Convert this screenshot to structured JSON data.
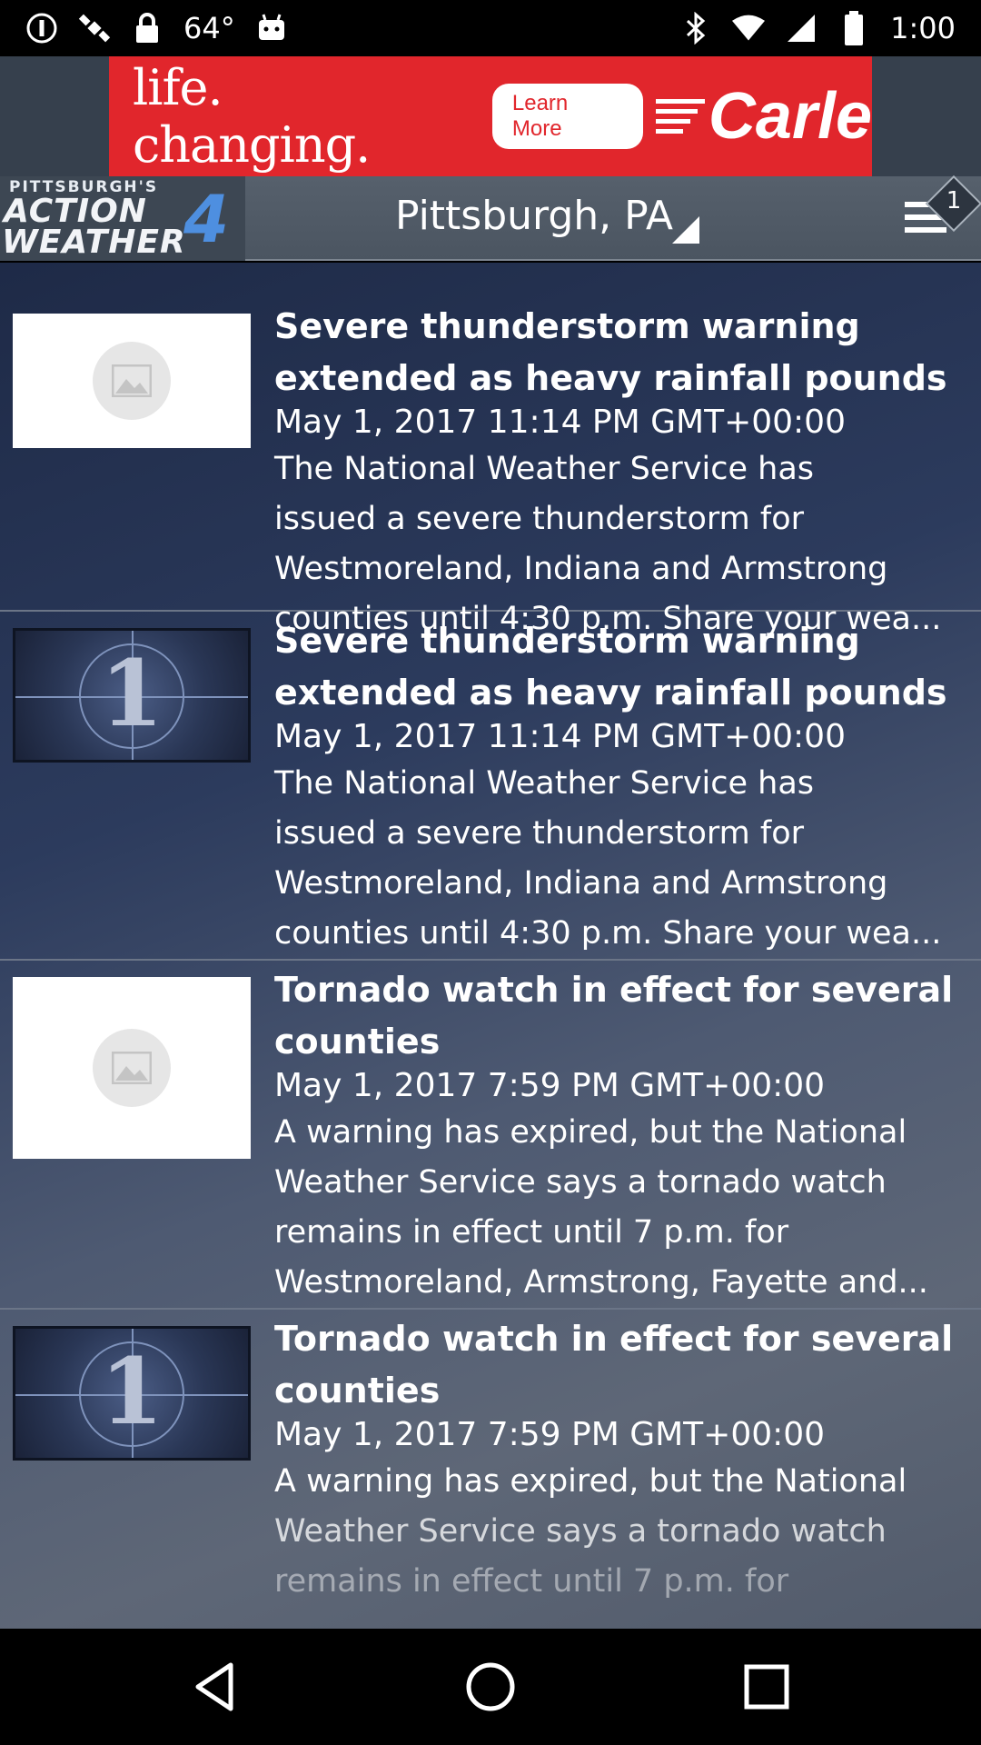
{
  "status_bar": {
    "temperature": "64°",
    "time": "1:00",
    "icons": [
      "info-icon",
      "satellite-icon",
      "lock-icon",
      "android-icon",
      "bluetooth-icon",
      "wifi-icon",
      "signal-icon",
      "battery-icon"
    ]
  },
  "ad": {
    "tagline": "life. changing.",
    "cta": "Learn More",
    "brand": "Carle",
    "color": "#e1262c"
  },
  "header": {
    "logo_top": "PITTSBURGH'S",
    "logo_line1": "ACTION",
    "logo_line2": "WEATHER",
    "logo_number": "4",
    "location": "Pittsburgh, PA",
    "badge_count": "1"
  },
  "articles": [
    {
      "thumbnail": "placeholder-image-icon",
      "title": "Severe thunderstorm warning extended as heavy rainfall pounds",
      "date": "May 1, 2017 11:14 PM GMT+00:00",
      "desc_lines": [
        "The National Weather Service has",
        "issued a severe thunderstorm for",
        "Westmoreland, Indiana and Armstrong",
        "counties until 4:30 p.m. Share your wea..."
      ]
    },
    {
      "thumbnail": "number-one-image",
      "thumb_digit": "1",
      "title": "Severe thunderstorm warning extended as heavy rainfall pounds",
      "date": "May 1, 2017 11:14 PM GMT+00:00",
      "desc_lines": [
        "The National Weather Service has",
        "issued a severe thunderstorm for",
        "Westmoreland, Indiana and Armstrong",
        "counties until 4:30 p.m. Share your wea..."
      ]
    },
    {
      "thumbnail": "placeholder-image-icon",
      "title": "Tornado watch in effect for several counties",
      "date": "May 1, 2017 7:59 PM GMT+00:00",
      "desc_lines": [
        "A warning has expired, but the National",
        "Weather Service says a tornado watch",
        "remains in effect until 7 p.m. for",
        "Westmoreland, Armstrong, Fayette and..."
      ]
    },
    {
      "thumbnail": "number-one-image",
      "thumb_digit": "1",
      "title": "Tornado watch in effect for several counties",
      "date": "May 1, 2017 7:59 PM GMT+00:00",
      "desc_lines": [
        "A warning has expired, but the National",
        "Weather Service says a tornado watch",
        "remains in effect until 7 p.m. for"
      ]
    }
  ],
  "nav": [
    "back-icon",
    "home-icon",
    "recents-icon"
  ]
}
